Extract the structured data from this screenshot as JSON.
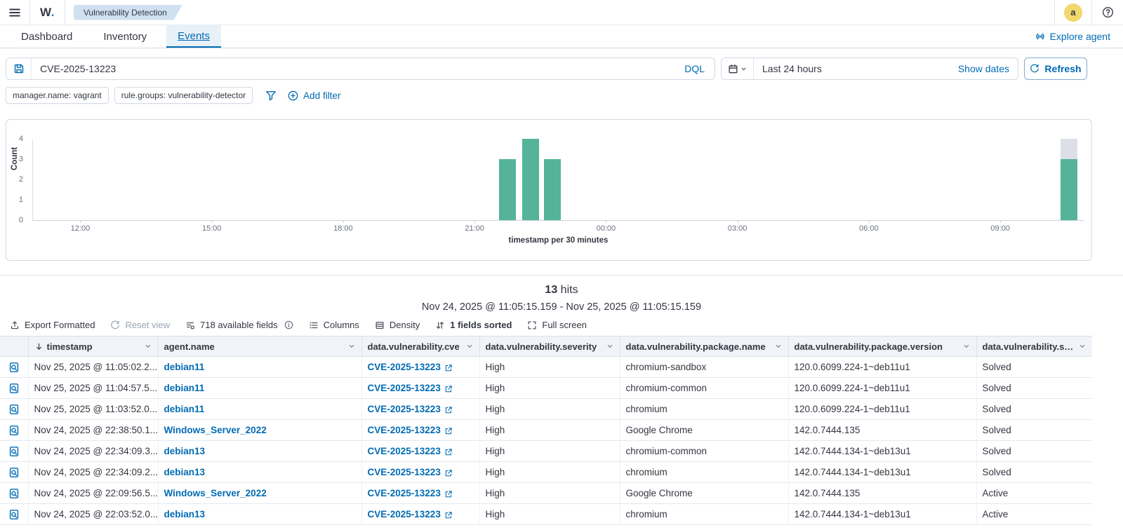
{
  "topbar": {
    "logo_w": "W",
    "logo_dot": ".",
    "breadcrumb": "Vulnerability Detection",
    "avatar_initial": "a"
  },
  "tabs": [
    {
      "label": "Dashboard",
      "active": false
    },
    {
      "label": "Inventory",
      "active": false
    },
    {
      "label": "Events",
      "active": true
    }
  ],
  "explore_agent_label": "Explore agent",
  "search_bar": {
    "query": "CVE-2025-13223",
    "language": "DQL",
    "time_range": "Last 24 hours",
    "show_dates_label": "Show dates",
    "refresh_label": "Refresh"
  },
  "filters": {
    "pills": [
      "manager.name: vagrant",
      "rule.groups: vulnerability-detector"
    ],
    "add_filter_label": "Add filter"
  },
  "chart_data": {
    "type": "bar",
    "title": "",
    "ylabel": "Count",
    "xlabel": "timestamp per 30 minutes",
    "ylim": [
      0,
      4
    ],
    "y_ticks": [
      0,
      1,
      2,
      3,
      4
    ],
    "x_ticks": [
      {
        "label": "12:00",
        "pos": 0.045
      },
      {
        "label": "15:00",
        "pos": 0.17
      },
      {
        "label": "18:00",
        "pos": 0.295
      },
      {
        "label": "21:00",
        "pos": 0.42
      },
      {
        "label": "00:00",
        "pos": 0.545
      },
      {
        "label": "03:00",
        "pos": 0.67
      },
      {
        "label": "06:00",
        "pos": 0.795
      },
      {
        "label": "09:00",
        "pos": 0.92
      }
    ],
    "bars": [
      {
        "time": "21:30",
        "count": 3,
        "pos": 0.451
      },
      {
        "time": "22:00",
        "count": 4,
        "pos": 0.473
      },
      {
        "time": "22:30",
        "count": 3,
        "pos": 0.494
      },
      {
        "time": "11:00",
        "count": 3,
        "partial_overlay": 1,
        "pos": 0.985
      }
    ],
    "bar_color": "#54b399",
    "partial_color": "#dce0e6",
    "grid": false,
    "legend": "none"
  },
  "results": {
    "hits_count": "13",
    "hits_label": "hits",
    "time_window": "Nov 24, 2025 @ 11:05:15.159 - Nov 25, 2025 @ 11:05:15.159"
  },
  "toolbar": {
    "export_label": "Export Formatted",
    "reset_label": "Reset view",
    "fields_label": "718 available fields",
    "columns_label": "Columns",
    "density_label": "Density",
    "sorted_label": "1 fields sorted",
    "fullscreen_label": "Full screen"
  },
  "table": {
    "headers": [
      "timestamp",
      "agent.name",
      "data.vulnerability.cve",
      "data.vulnerability.severity",
      "data.vulnerability.package.name",
      "data.vulnerability.package.version",
      "data.vulnerability.status"
    ],
    "rows": [
      {
        "timestamp": "Nov 25, 2025 @ 11:05:02.2...",
        "agent": "debian11",
        "cve": "CVE-2025-13223",
        "severity": "High",
        "package": "chromium-sandbox",
        "version": "120.0.6099.224-1~deb11u1",
        "status": "Solved"
      },
      {
        "timestamp": "Nov 25, 2025 @ 11:04:57.5...",
        "agent": "debian11",
        "cve": "CVE-2025-13223",
        "severity": "High",
        "package": "chromium-common",
        "version": "120.0.6099.224-1~deb11u1",
        "status": "Solved"
      },
      {
        "timestamp": "Nov 25, 2025 @ 11:03:52.0...",
        "agent": "debian11",
        "cve": "CVE-2025-13223",
        "severity": "High",
        "package": "chromium",
        "version": "120.0.6099.224-1~deb11u1",
        "status": "Solved"
      },
      {
        "timestamp": "Nov 24, 2025 @ 22:38:50.1...",
        "agent": "Windows_Server_2022",
        "cve": "CVE-2025-13223",
        "severity": "High",
        "package": "Google Chrome",
        "version": "142.0.7444.135",
        "status": "Solved"
      },
      {
        "timestamp": "Nov 24, 2025 @ 22:34:09.3...",
        "agent": "debian13",
        "cve": "CVE-2025-13223",
        "severity": "High",
        "package": "chromium-common",
        "version": "142.0.7444.134-1~deb13u1",
        "status": "Solved"
      },
      {
        "timestamp": "Nov 24, 2025 @ 22:34:09.2...",
        "agent": "debian13",
        "cve": "CVE-2025-13223",
        "severity": "High",
        "package": "chromium",
        "version": "142.0.7444.134-1~deb13u1",
        "status": "Solved"
      },
      {
        "timestamp": "Nov 24, 2025 @ 22:09:56.5...",
        "agent": "Windows_Server_2022",
        "cve": "CVE-2025-13223",
        "severity": "High",
        "package": "Google Chrome",
        "version": "142.0.7444.135",
        "status": "Active"
      },
      {
        "timestamp": "Nov 24, 2025 @ 22:03:52.0...",
        "agent": "debian13",
        "cve": "CVE-2025-13223",
        "severity": "High",
        "package": "chromium",
        "version": "142.0.7444.134-1~deb13u1",
        "status": "Active"
      }
    ]
  }
}
